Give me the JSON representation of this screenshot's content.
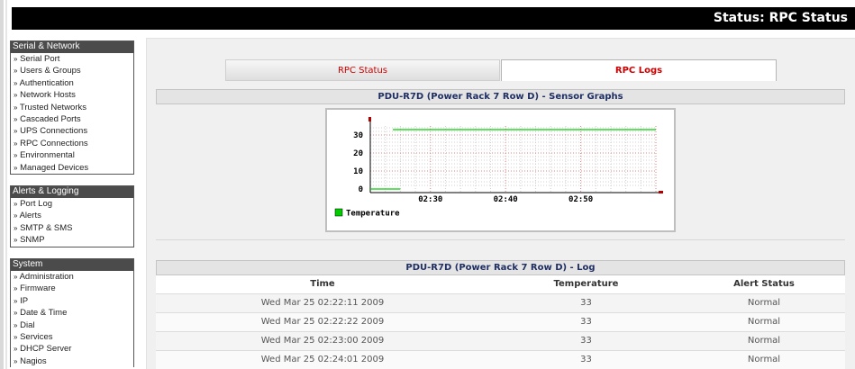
{
  "header": {
    "title": "Status: RPC Status"
  },
  "menus": [
    {
      "title": "Serial & Network",
      "items": [
        "Serial Port",
        "Users & Groups",
        "Authentication",
        "Network Hosts",
        "Trusted Networks",
        "Cascaded Ports",
        "UPS Connections",
        "RPC Connections",
        "Environmental",
        "Managed Devices"
      ]
    },
    {
      "title": "Alerts & Logging",
      "items": [
        "Port Log",
        "Alerts",
        "SMTP & SMS",
        "SNMP"
      ]
    },
    {
      "title": "System",
      "items": [
        "Administration",
        "Firmware",
        "IP",
        "Date & Time",
        "Dial",
        "Services",
        "DHCP Server",
        "Nagios"
      ]
    }
  ],
  "menu_bullet": "»",
  "tabs": {
    "rpc_status": "RPC Status",
    "rpc_logs": "RPC Logs",
    "active": "rpc_logs"
  },
  "graph_panel": {
    "title": "PDU-R7D (Power Rack 7 Row D) - Sensor Graphs"
  },
  "chart_data": {
    "type": "line",
    "title": "",
    "xlabel": "",
    "ylabel": "",
    "y_ticks": [
      0,
      10,
      20,
      30
    ],
    "x_ticks": [
      "02:30",
      "02:40",
      "02:50"
    ],
    "series": [
      {
        "name": "Temperature",
        "color": "#00cc00",
        "x": [
          "02:22",
          "02:23",
          "02:24",
          "02:25",
          "02:26"
        ],
        "values": [
          0,
          0,
          0,
          0,
          0
        ]
      },
      {
        "name": "",
        "color": "#00cc00",
        "x": [
          "02:25",
          "03:00"
        ],
        "values": [
          33,
          33
        ]
      }
    ],
    "grid": true,
    "legend": "bottom-left"
  },
  "log_panel": {
    "title": "PDU-R7D (Power Rack 7 Row D) - Log",
    "columns": [
      "Time",
      "Temperature",
      "Alert Status"
    ],
    "rows": [
      [
        "Wed Mar 25 02:22:11 2009",
        "33",
        "Normal"
      ],
      [
        "Wed Mar 25 02:22:22 2009",
        "33",
        "Normal"
      ],
      [
        "Wed Mar 25 02:23:00 2009",
        "33",
        "Normal"
      ],
      [
        "Wed Mar 25 02:24:01 2009",
        "33",
        "Normal"
      ]
    ]
  }
}
